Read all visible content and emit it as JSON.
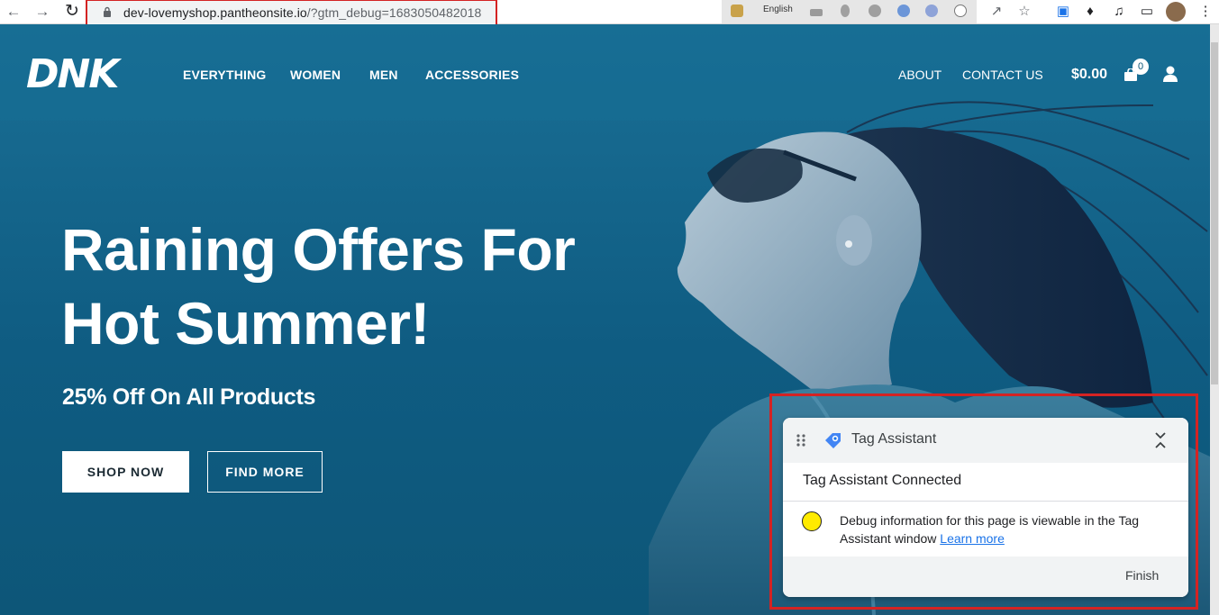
{
  "browser": {
    "url_host": "dev-lovemyshop.pantheonsite.io",
    "url_path": "/?gtm_debug=1683050482018",
    "extension_language": "English",
    "icons": {
      "back": "back-arrow-icon",
      "forward": "forward-arrow-icon",
      "reload": "reload-icon",
      "share": "share-icon",
      "bookmark": "star-icon",
      "extensions": "puzzle-icon",
      "media": "media-icon",
      "sidepanel": "sidepanel-icon",
      "menu": "kebab-menu-icon"
    },
    "highlight_color": "#d42323"
  },
  "site": {
    "logo": "DNK",
    "nav": [
      "EVERYTHING",
      "WOMEN",
      "MEN",
      "ACCESSORIES"
    ],
    "right_links": [
      "ABOUT",
      "CONTACT US"
    ],
    "cart_total": "$0.00",
    "cart_count": "0"
  },
  "hero": {
    "headline_line1": "Raining Offers For",
    "headline_line2": "Hot Summer!",
    "subhead": "25% Off On All Products",
    "primary_cta": "SHOP NOW",
    "secondary_cta": "FIND MORE"
  },
  "tag_assistant": {
    "title": "Tag Assistant",
    "status": "Tag Assistant Connected",
    "info_text": "Debug information for this page is viewable in the Tag Assistant window",
    "learn_more": "Learn more",
    "finish": "Finish",
    "status_color": "#ffeb00"
  }
}
